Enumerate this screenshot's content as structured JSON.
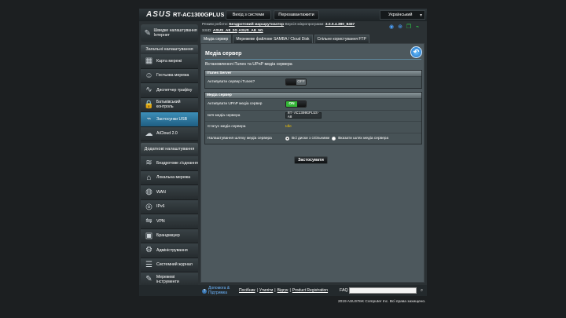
{
  "header": {
    "logo": "ASUS",
    "model": "RT-AC1300GPLUS",
    "logout_label": "Вихід з системи",
    "reboot_label": "Перезавантажити",
    "language": "Український"
  },
  "info": {
    "mode_label": "Режим роботи:",
    "mode_value": "Бездротовий маршрутизатор",
    "firmware_label": "Версія мікропрограми:",
    "firmware_value": "3.0.0.4.380_8457",
    "ssid_label": "SSID:",
    "ssid_24": "ASUS_A8_2G",
    "ssid_5": "ASUS_A8_5G"
  },
  "sidebar": {
    "quick_setup": "Швидке налаштування Інтернет",
    "general_head": "Загальні налаштування",
    "general_items": [
      {
        "label": "Карта мережі",
        "icon": "network-map-icon",
        "glyph": "▦"
      },
      {
        "label": "Гостьова мережа",
        "icon": "guest-network-icon",
        "glyph": "☺"
      },
      {
        "label": "Диспетчер трафіку",
        "icon": "traffic-manager-icon",
        "glyph": "∿"
      },
      {
        "label": "Батьківський контроль",
        "icon": "parental-control-icon",
        "glyph": "🔒"
      },
      {
        "label": "Застосунки USB",
        "icon": "usb-icon",
        "glyph": "⌁"
      },
      {
        "label": "AiCloud 2.0",
        "icon": "aicloud-icon",
        "glyph": "☁"
      }
    ],
    "advanced_head": "Додаткові налаштування",
    "advanced_items": [
      {
        "label": "Бездротове з’єднання",
        "icon": "wireless-icon",
        "glyph": "≋"
      },
      {
        "label": "Локальна мережа",
        "icon": "lan-icon",
        "glyph": "⌂"
      },
      {
        "label": "WAN",
        "icon": "wan-icon",
        "glyph": "◍"
      },
      {
        "label": "IPv6",
        "icon": "ipv6-icon",
        "glyph": "◎"
      },
      {
        "label": "VPN",
        "icon": "vpn-icon",
        "glyph": "⇋"
      },
      {
        "label": "Брандмауер",
        "icon": "firewall-icon",
        "glyph": "▣"
      },
      {
        "label": "Адміністрування",
        "icon": "administration-icon",
        "glyph": "⚙"
      },
      {
        "label": "Системний журнал",
        "icon": "system-log-icon",
        "glyph": "☰"
      },
      {
        "label": "Мережеві інструменти",
        "icon": "network-tools-icon",
        "glyph": "✎"
      }
    ]
  },
  "tabs": [
    "Медіа сервер",
    "Мережеве файлове SAMBA / Cloud Disk",
    "Спільне користування FTP"
  ],
  "main": {
    "title": "Медіа сервер",
    "description": "Встановлення iTunes та UPnP медіа сервера",
    "itunes_head": "iTunes Server",
    "itunes_label": "Активувати сервер iTunes?",
    "itunes_toggle": "OFF",
    "media_head": "Медіа сервер",
    "upnp_label": "Активувати UPnP медіа сервер",
    "upnp_toggle": "ON",
    "name_label": "Ім'я медіа сервера",
    "name_value": "RT-AC1300GPLUS-A8",
    "status_label": "Статус медіа сервера",
    "status_value": "Idle",
    "path_label": "Налаштування шляху медіа сервера",
    "path_opt1": "Всі диски з спільними",
    "path_opt2": "Вказати шлях медіа сервера",
    "apply_label": "Застосувати"
  },
  "footer": {
    "help": "Допомога & Підтримка",
    "link1": "Посібник",
    "link2": "Утиліти",
    "link3": "Відгук",
    "link4": "Product Registration",
    "sep": "|",
    "faq": "FAQ"
  },
  "copyright": "2019 ASUSTeK Computer Inc. Всі права захищено."
}
